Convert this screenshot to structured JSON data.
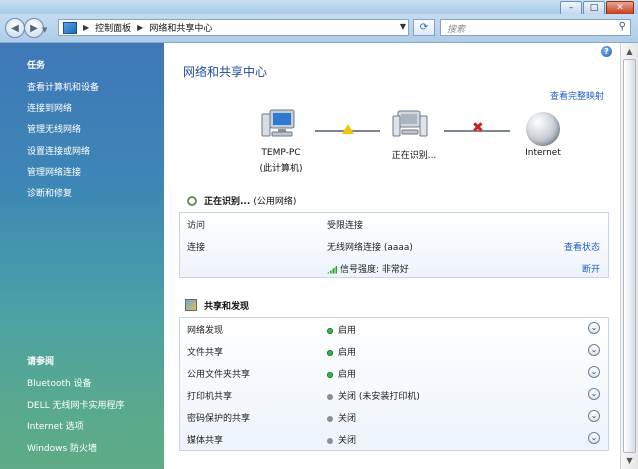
{
  "window": {
    "buttons": {
      "minimize": "–",
      "maximize": "□",
      "close": "✕"
    }
  },
  "nav": {
    "breadcrumb": [
      "控制面板",
      "网络和共享中心"
    ],
    "search_placeholder": "搜索"
  },
  "sidebar": {
    "tasks_header": "任务",
    "tasks": [
      "查看计算机和设备",
      "连接到网络",
      "管理无线网络",
      "设置连接或网络",
      "管理网络连接",
      "诊断和修复"
    ],
    "see_also_header": "请参阅",
    "see_also": [
      "Bluetooth 设备",
      "DELL 无线网卡实用程序",
      "Internet 选项",
      "Windows 防火墙"
    ]
  },
  "main": {
    "title": "网络和共享中心",
    "full_map_link": "查看完整映射",
    "map": {
      "pc_name": "TEMP-PC",
      "pc_sub": "(此计算机)",
      "middle": "正在识别...",
      "internet": "Internet"
    },
    "network": {
      "name": "正在识别...",
      "type": "(公用网络)",
      "access_label": "访问",
      "access_value": "受限连接",
      "connection_label": "连接",
      "connection_value": "无线网络连接 (aaaa)",
      "view_status": "查看状态",
      "signal": "信号强度:  非常好",
      "disconnect": "断开"
    },
    "sharing": {
      "header": "共享和发现",
      "rows": [
        {
          "label": "网络发现",
          "value": "启用",
          "state": "on"
        },
        {
          "label": "文件共享",
          "value": "启用",
          "state": "on"
        },
        {
          "label": "公用文件夹共享",
          "value": "启用",
          "state": "on"
        },
        {
          "label": "打印机共享",
          "value": "关闭 (未安装打印机)",
          "state": "off"
        },
        {
          "label": "密码保护的共享",
          "value": "关闭",
          "state": "off"
        },
        {
          "label": "媒体共享",
          "value": "关闭",
          "state": "off"
        }
      ]
    }
  },
  "colors": {
    "accent_link": "#1f5fc8",
    "status_on": "#35b84a",
    "status_off": "#8e8e8e"
  }
}
